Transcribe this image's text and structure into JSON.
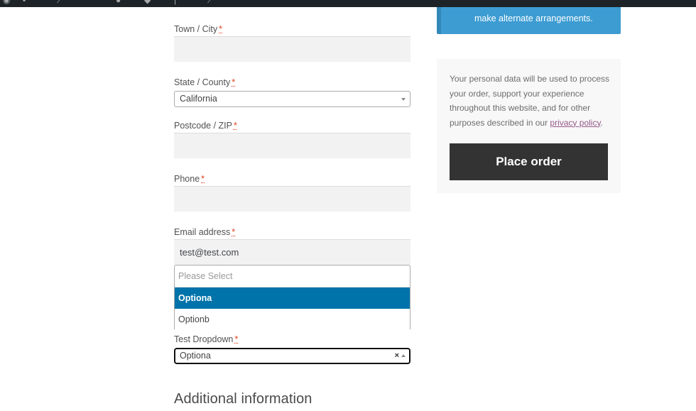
{
  "admin_bar": {
    "icons": [
      "wordpress-logo-icon",
      "site-icon",
      "customize-icon",
      "updates-icon",
      "comments-icon",
      "new-content-icon",
      "edit-icon"
    ]
  },
  "notice": {
    "text": "make alternate arrangements.",
    "color": "#3d9cd2"
  },
  "form": {
    "required_mark": "*",
    "town": {
      "label": "Town / City",
      "value": ""
    },
    "state": {
      "label": "State / County",
      "value": "California"
    },
    "postcode": {
      "label": "Postcode / ZIP",
      "value": ""
    },
    "phone": {
      "label": "Phone",
      "value": ""
    },
    "email": {
      "label": "Email address",
      "value": "test@test.com"
    },
    "test_dropdown": {
      "label": "Test Dropdown",
      "value": "Optiona",
      "clear_symbol": "×",
      "search_placeholder": "Please Select",
      "options": [
        "Optiona",
        "Optionb"
      ],
      "highlighted": "Optiona",
      "highlight_color": "#0073aa"
    }
  },
  "additional_info": {
    "title": "Additional information"
  },
  "sidebar": {
    "privacy_text_before": "Your personal data will be used to process your order, support your experience throughout this website, and for other purposes described in our ",
    "privacy_link": "privacy policy",
    "privacy_text_after": ".",
    "place_order_label": "Place order",
    "link_color": "#96588a",
    "button_color": "#333333"
  }
}
